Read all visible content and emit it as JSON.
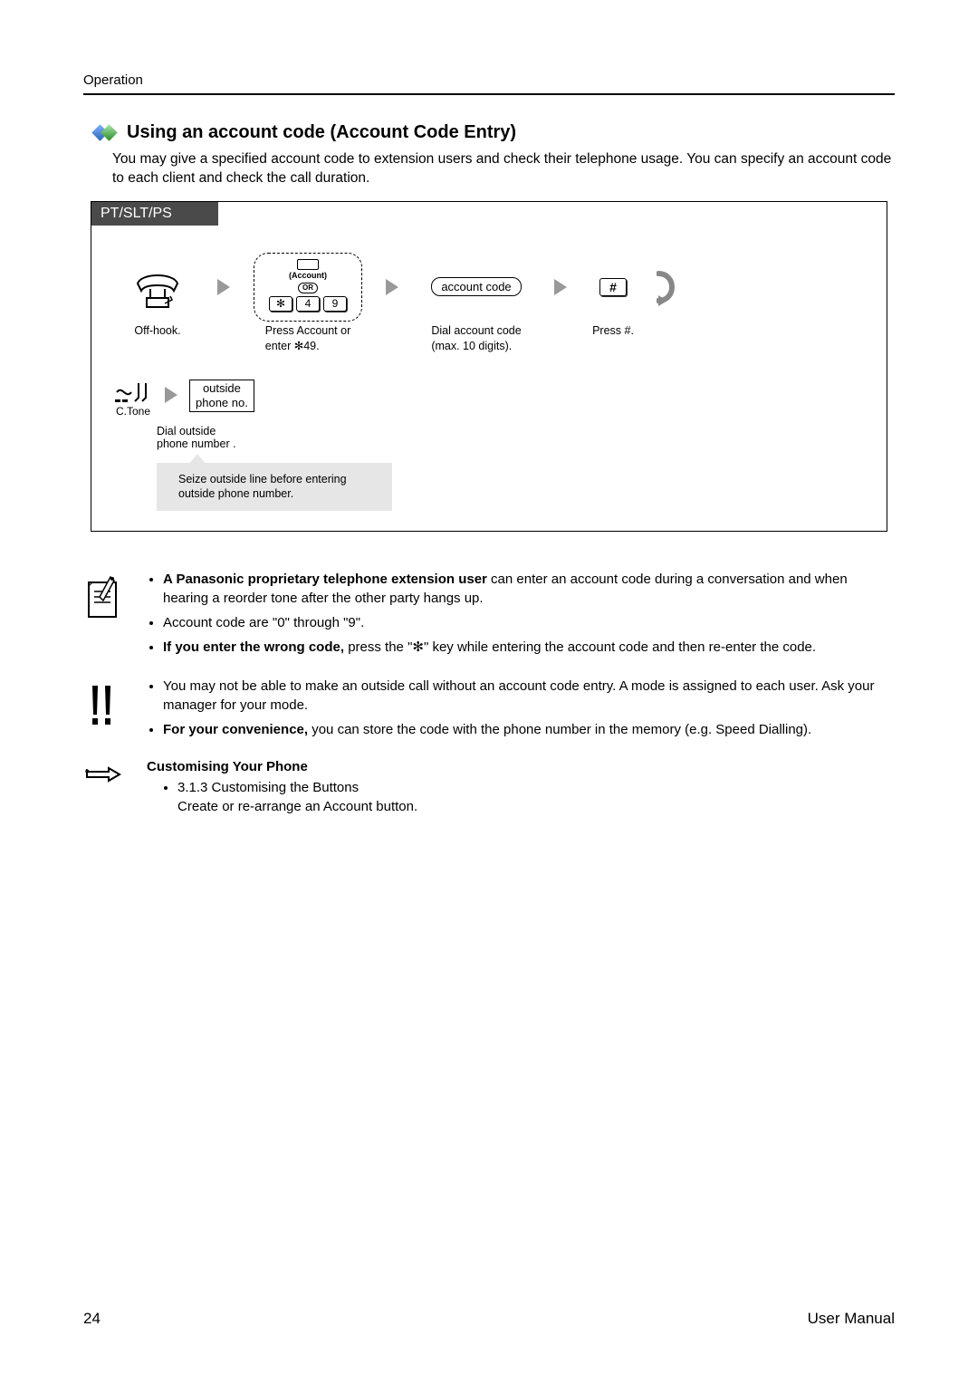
{
  "header": {
    "section": "Operation"
  },
  "section": {
    "title": "Using an account code (Account Code Entry)",
    "intro": "You may give a specified account code to extension users and check their telephone usage. You can specify an account code to each client and check the call duration."
  },
  "procedure": {
    "device_tab": "PT/SLT/PS",
    "steps": {
      "offhook": {
        "caption": "Off-hook."
      },
      "press_account": {
        "button_label": "(Account)",
        "or": "OR",
        "keys": [
          "✻",
          "4",
          "9"
        ],
        "caption_line1": "Press Account  or",
        "caption_line2": "enter   49.",
        "star_for_caption": "✻"
      },
      "dial_code": {
        "pill": "account code",
        "caption_line1": "Dial account code",
        "caption_line2": "(max. 10 digits)."
      },
      "press_hash": {
        "key": "#",
        "caption": "Press #."
      }
    },
    "row2": {
      "tone_label": "C.Tone",
      "outside_box_line1": "outside",
      "outside_box_line2": "phone  no.",
      "dial_caption": "Dial outside phone number .",
      "note": "Seize outside line before entering outside phone number."
    }
  },
  "notes": {
    "b1_lead": "A Panasonic proprietary telephone extension user",
    "b1_rest": " can enter an account code during a conversation and when hearing a reorder tone after the other party hangs up.",
    "b2": "Account code are \"0\" through \"9\".",
    "b3_lead": "If you enter the wrong code,",
    "b3_rest": " press the \"✻\" key while entering the account code and then re-enter the code."
  },
  "caution": {
    "c1": "You may not be able to make an outside call without an account code entry. A mode is assigned to each user. Ask your manager for your mode.",
    "c2_lead": "For your convenience,",
    "c2_rest": " you can store the code with the phone number in the memory (e.g. Speed Dialling)."
  },
  "customise": {
    "heading": "Customising Your Phone",
    "item_ref": "3.1.3   Customising the Buttons",
    "item_desc": "Create or re-arrange an Account button."
  },
  "footer": {
    "page": "24",
    "doc": "User Manual"
  }
}
